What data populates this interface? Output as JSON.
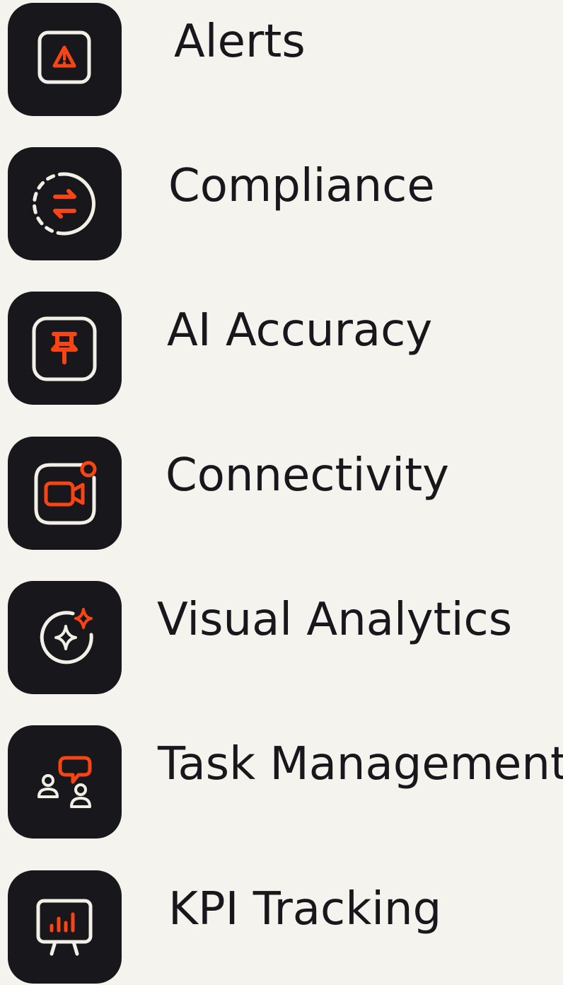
{
  "colors": {
    "page_background": "#f4f3ed",
    "tile_background": "#18171c",
    "icon_outline": "#f2f0e6",
    "icon_accent": "#fa4414",
    "label_text": "#18171c"
  },
  "items": [
    {
      "label": "Alerts",
      "icon": "warning-icon"
    },
    {
      "label": "Compliance",
      "icon": "exchange-icon"
    },
    {
      "label": "AI Accuracy",
      "icon": "pin-icon"
    },
    {
      "label": "Connectivity",
      "icon": "video-call-icon"
    },
    {
      "label": "Visual Analytics",
      "icon": "sparkle-icon"
    },
    {
      "label": "Task Management",
      "icon": "team-chat-icon"
    },
    {
      "label": "KPI Tracking",
      "icon": "presentation-chart-icon"
    }
  ]
}
